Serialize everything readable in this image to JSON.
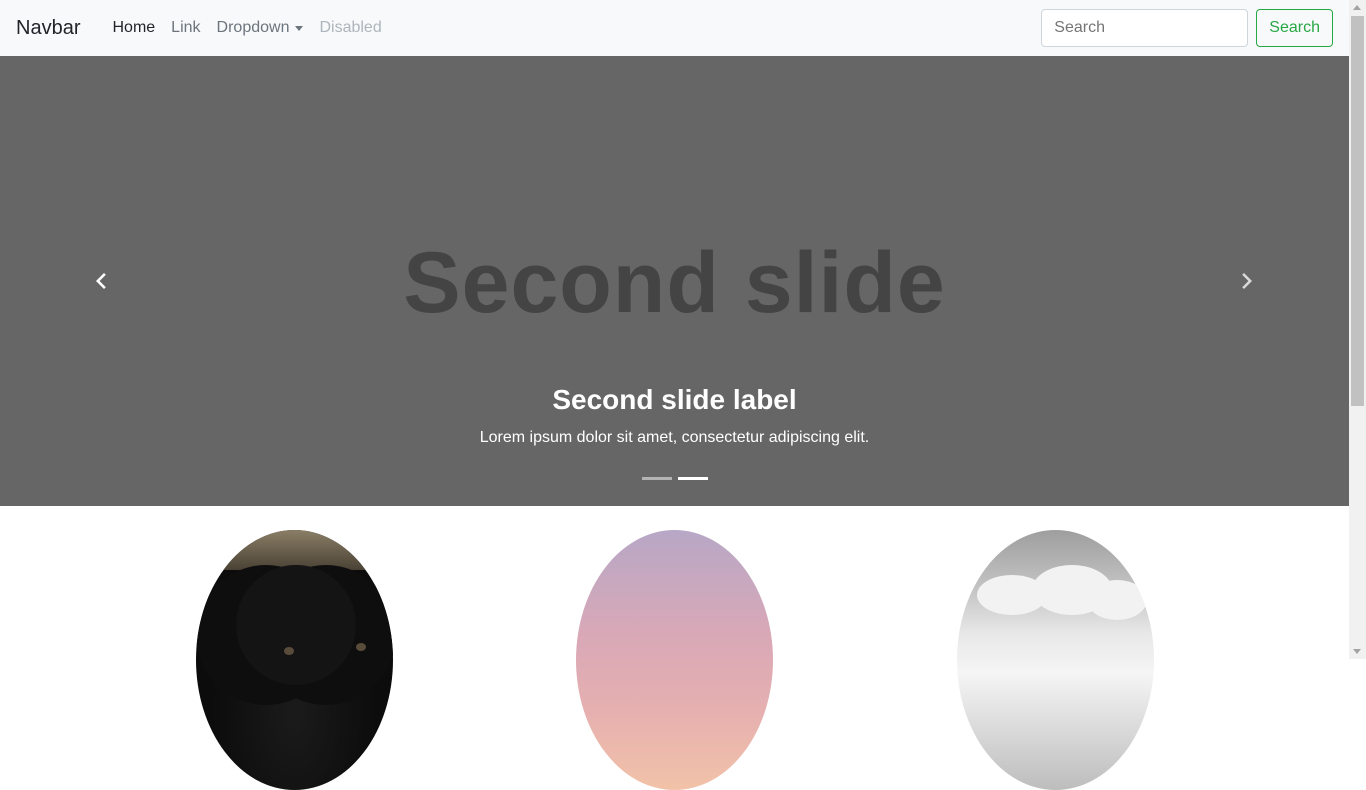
{
  "navbar": {
    "brand": "Navbar",
    "links": [
      {
        "label": "Home",
        "state": "active"
      },
      {
        "label": "Link",
        "state": "normal"
      },
      {
        "label": "Dropdown",
        "state": "dropdown"
      },
      {
        "label": "Disabled",
        "state": "disabled"
      }
    ],
    "search": {
      "placeholder": "Search",
      "button_label": "Search"
    }
  },
  "carousel": {
    "placeholder_text": "Second slide",
    "caption_title": "Second slide label",
    "caption_text": "Lorem ipsum dolor sit amet, consectetur adipiscing elit.",
    "indicators": [
      {
        "active": false
      },
      {
        "active": true
      }
    ],
    "prev_icon": "chevron-left-icon",
    "next_icon": "chevron-right-icon",
    "background_color": "#666666"
  },
  "accent_color": "#28a745"
}
